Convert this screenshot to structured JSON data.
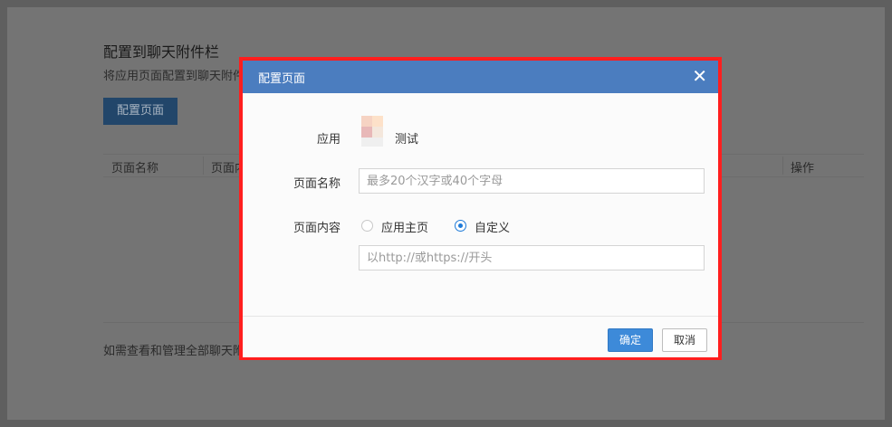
{
  "background": {
    "title": "配置到聊天附件栏",
    "subtitle": "将应用页面配置到聊天附件",
    "config_button": "配置页面",
    "columns": [
      "页面名称",
      "页面内",
      "操作"
    ],
    "footer_text": "如需查看和管理全部聊天附件"
  },
  "dialog": {
    "title": "配置页面",
    "close_glyph": "✕",
    "app_label": "应用",
    "app_name": "测试",
    "page_name_label": "页面名称",
    "page_name_placeholder": "最多20个汉字或40个字母",
    "page_content_label": "页面内容",
    "radio_home": "应用主页",
    "radio_custom": "自定义",
    "selected_option": "自定义",
    "url_placeholder": "以http://或https://开头",
    "confirm_button": "确定",
    "cancel_button": "取消"
  },
  "colors": {
    "header": "#4b7dbf",
    "highlight_border": "#ff1e1e",
    "primary_button": "#3d8ad9"
  }
}
